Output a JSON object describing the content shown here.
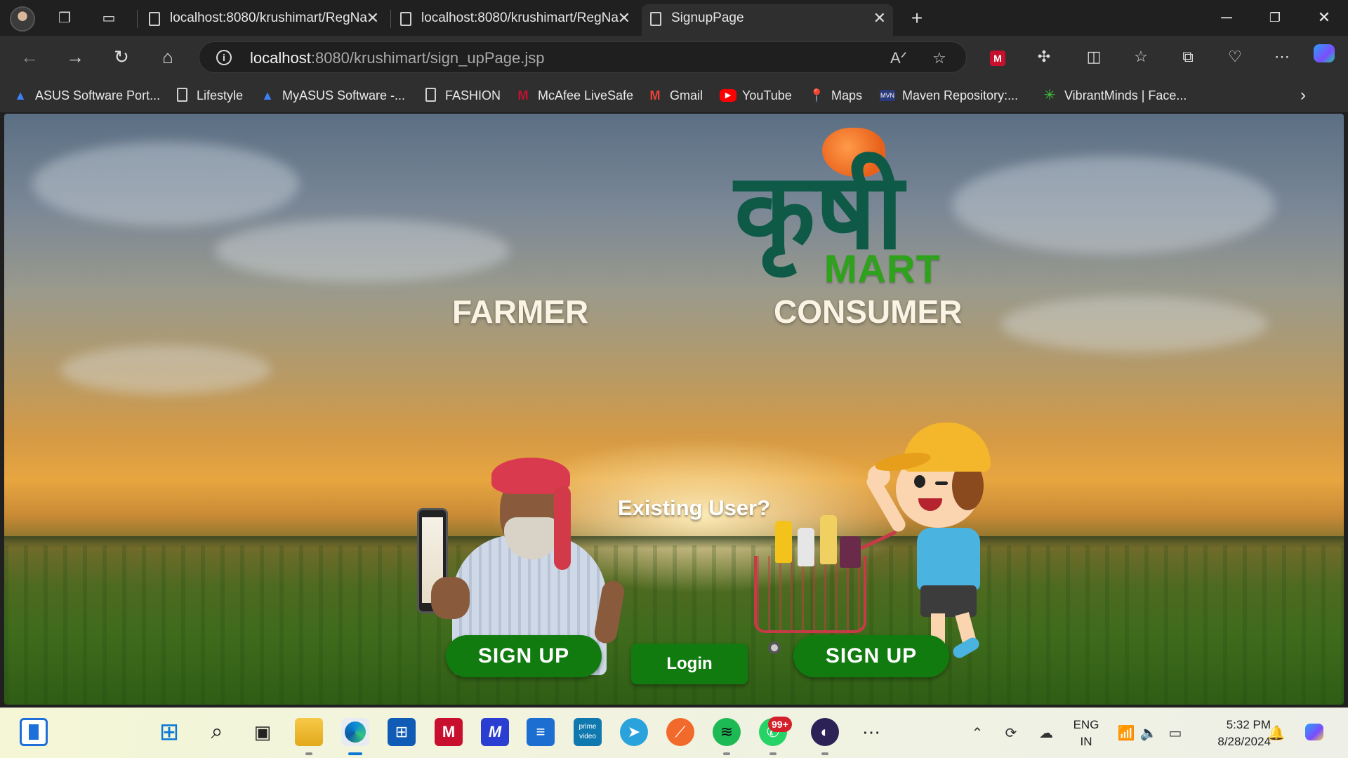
{
  "browser": {
    "tabs": [
      {
        "title": "localhost:8080/krushimart/RegNa"
      },
      {
        "title": "localhost:8080/krushimart/RegNa"
      },
      {
        "title": "SignupPage"
      }
    ],
    "address": {
      "host": "localhost",
      "rest": ":8080/krushimart/sign_upPage.jsp"
    },
    "bookmarks": [
      {
        "label": "ASUS Software Port...",
        "icon": "asus-icon"
      },
      {
        "label": "Lifestyle",
        "icon": "page-icon"
      },
      {
        "label": "MyASUS Software -...",
        "icon": "asus-icon"
      },
      {
        "label": "FASHION",
        "icon": "page-icon"
      },
      {
        "label": "McAfee LiveSafe",
        "icon": "mcafee-icon"
      },
      {
        "label": "Gmail",
        "icon": "gmail-icon"
      },
      {
        "label": "YouTube",
        "icon": "youtube-icon"
      },
      {
        "label": "Maps",
        "icon": "maps-icon"
      },
      {
        "label": "Maven Repository:...",
        "icon": "maven-icon"
      },
      {
        "label": "VibrantMinds | Face...",
        "icon": "vibrantminds-icon"
      }
    ]
  },
  "page": {
    "logo": {
      "devanagari": "कृषी",
      "mart": "MART"
    },
    "farmer_heading": "FARMER",
    "consumer_heading": "CONSUMER",
    "existing_user": "Existing User?",
    "farmer_signup": "SIGN UP",
    "consumer_signup": "SIGN UP",
    "login": "Login"
  },
  "taskbar": {
    "notification_badge": "99+",
    "language": "ENG",
    "region": "IN",
    "time": "5:32 PM",
    "date": "8/28/2024"
  },
  "colors": {
    "button_green": "#117b10",
    "logo_green": "#0e5a47",
    "mart_green": "#2ea21a",
    "turban_orange": "#e8611a"
  }
}
